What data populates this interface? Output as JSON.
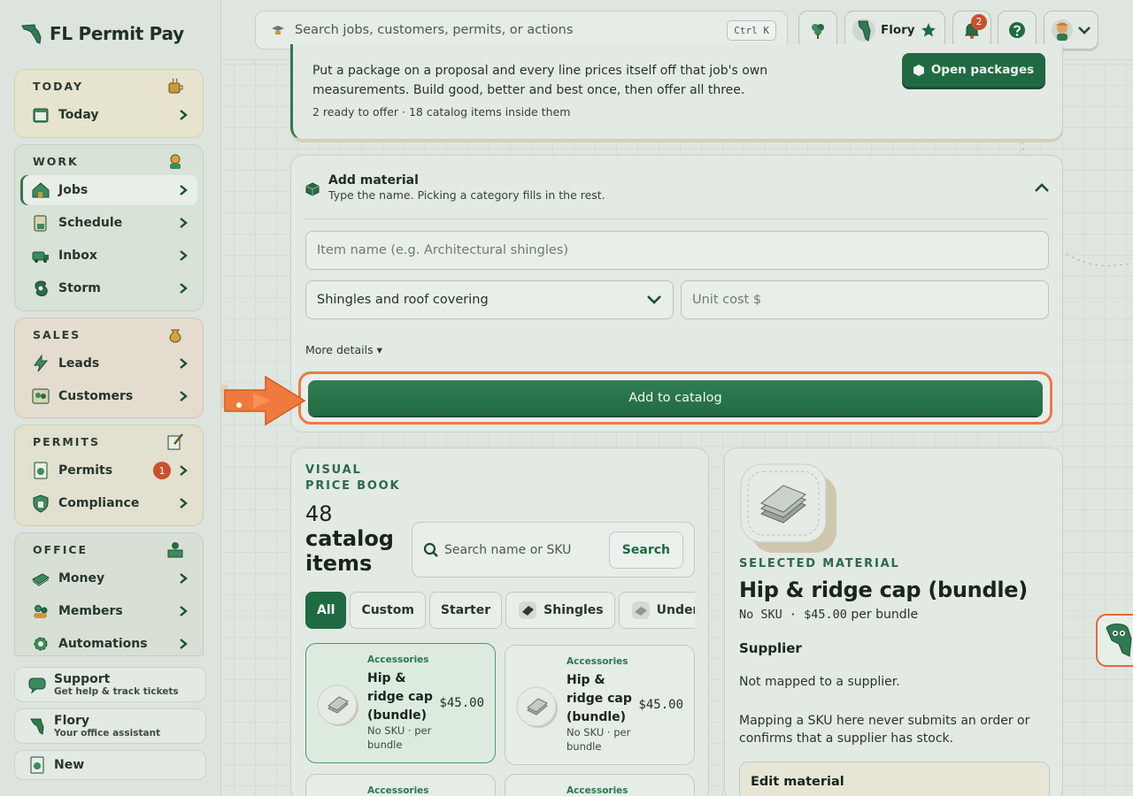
{
  "brand": {
    "title": "FL Permit Pay"
  },
  "sidebar": {
    "groups": {
      "today": {
        "title": "TODAY",
        "items": [
          {
            "label": "Today"
          }
        ]
      },
      "work": {
        "title": "WORK",
        "items": [
          {
            "label": "Jobs"
          },
          {
            "label": "Schedule"
          },
          {
            "label": "Inbox"
          },
          {
            "label": "Storm"
          }
        ]
      },
      "sales": {
        "title": "SALES",
        "items": [
          {
            "label": "Leads"
          },
          {
            "label": "Customers"
          }
        ]
      },
      "permits": {
        "title": "PERMITS",
        "items": [
          {
            "label": "Permits",
            "badge": "1"
          },
          {
            "label": "Compliance"
          }
        ]
      },
      "office": {
        "title": "OFFICE",
        "items": [
          {
            "label": "Money"
          },
          {
            "label": "Members"
          },
          {
            "label": "Automations"
          }
        ]
      }
    },
    "bottom": {
      "support": {
        "title": "Support",
        "sub": "Get help & track tickets"
      },
      "flory": {
        "title": "Flory",
        "sub": "Your office assistant"
      },
      "new": {
        "title": "New"
      }
    }
  },
  "topbar": {
    "search_placeholder": "Search jobs, customers, permits, or actions",
    "shortcut": "Ctrl K",
    "assistant_name": "Flory",
    "notifications_count": "2"
  },
  "packages": {
    "text": "Put a package on a proposal and every line prices itself off that job's own measurements. Build good, better and best once, then offer all three.",
    "sub": "2 ready to offer · 18 catalog items inside them",
    "button": "Open packages"
  },
  "add_material": {
    "title": "Add material",
    "sub": "Type the name. Picking a category fills in the rest.",
    "name_placeholder": "Item name (e.g. Architectural shingles)",
    "category_value": "Shingles and roof covering",
    "cost_placeholder": "Unit cost $",
    "more_details": "More details ▾",
    "submit": "Add to catalog"
  },
  "price_book": {
    "label": "VISUAL PRICE BOOK",
    "count": "48",
    "count_label": "catalog items",
    "search_placeholder": "Search name or SKU",
    "search_button": "Search",
    "chips": [
      {
        "label": "All"
      },
      {
        "label": "Custom"
      },
      {
        "label": "Starter"
      },
      {
        "label": "Shingles"
      },
      {
        "label": "Underl"
      }
    ],
    "items": [
      {
        "category": "Accessories",
        "name": "Hip & ridge cap (bundle)",
        "price": "$45.00",
        "meta": "No SKU · per bundle"
      },
      {
        "category": "Accessories",
        "name": "Hip & ridge cap (bundle)",
        "price": "$45.00",
        "meta": "No SKU · per bundle"
      },
      {
        "category": "Accessories"
      },
      {
        "category": "Accessories"
      }
    ]
  },
  "selected": {
    "label": "SELECTED MATERIAL",
    "title": "Hip & ridge cap (bundle)",
    "sku_price": "No SKU · $45.00",
    "unit": "per bundle",
    "supplier_heading": "Supplier",
    "supplier_status": "Not mapped to a supplier.",
    "supplier_note": "Mapping a SKU here never submits an order or confirms that a supplier has stock.",
    "edit_heading": "Edit material"
  },
  "colors": {
    "brand_green": "#1f6a43",
    "accent_orange": "#ef7a45",
    "badge_red": "#c9512e"
  }
}
